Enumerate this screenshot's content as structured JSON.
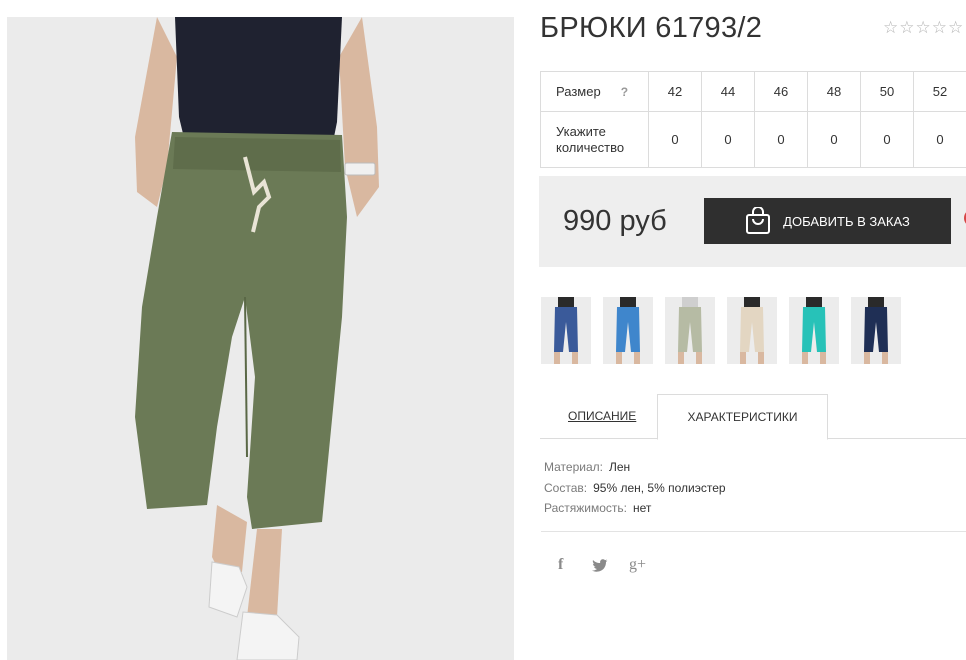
{
  "product": {
    "title": "БРЮКИ 61793/2",
    "rating_stars": "☆☆☆☆☆"
  },
  "sizes": {
    "size_label": "Размер",
    "help_icon": "?",
    "qty_label_line1": "Укажите",
    "qty_label_line2": "количество",
    "values": [
      "42",
      "44",
      "46",
      "48",
      "50",
      "52"
    ],
    "quantities": [
      "0",
      "0",
      "0",
      "0",
      "0",
      "0"
    ]
  },
  "buy": {
    "price": "990 руб",
    "button_label": "ДОБАВИТЬ В ЗАКАЗ",
    "button_icon": "shopping-bag-icon"
  },
  "colors": {
    "variant_pants": [
      "#3a5a9a",
      "#3f86cc",
      "#b6bba4",
      "#e3d6c2",
      "#27c2b8",
      "#1f2f55"
    ],
    "main_pants": "#6b7a56",
    "accent_dark": "#2f2f2f",
    "accent_red": "#d64545"
  },
  "tabs": {
    "description": "ОПИСАНИЕ",
    "characteristics": "ХАРАКТЕРИСТИКИ"
  },
  "characteristics": [
    {
      "key": "Материал:",
      "value": "Лен"
    },
    {
      "key": "Состав:",
      "value": "95% лен, 5% полиэстер"
    },
    {
      "key": "Растяжимость:",
      "value": "нет"
    }
  ],
  "social": {
    "facebook": "f",
    "twitter": "twitter-bird-icon",
    "google": "g+"
  }
}
